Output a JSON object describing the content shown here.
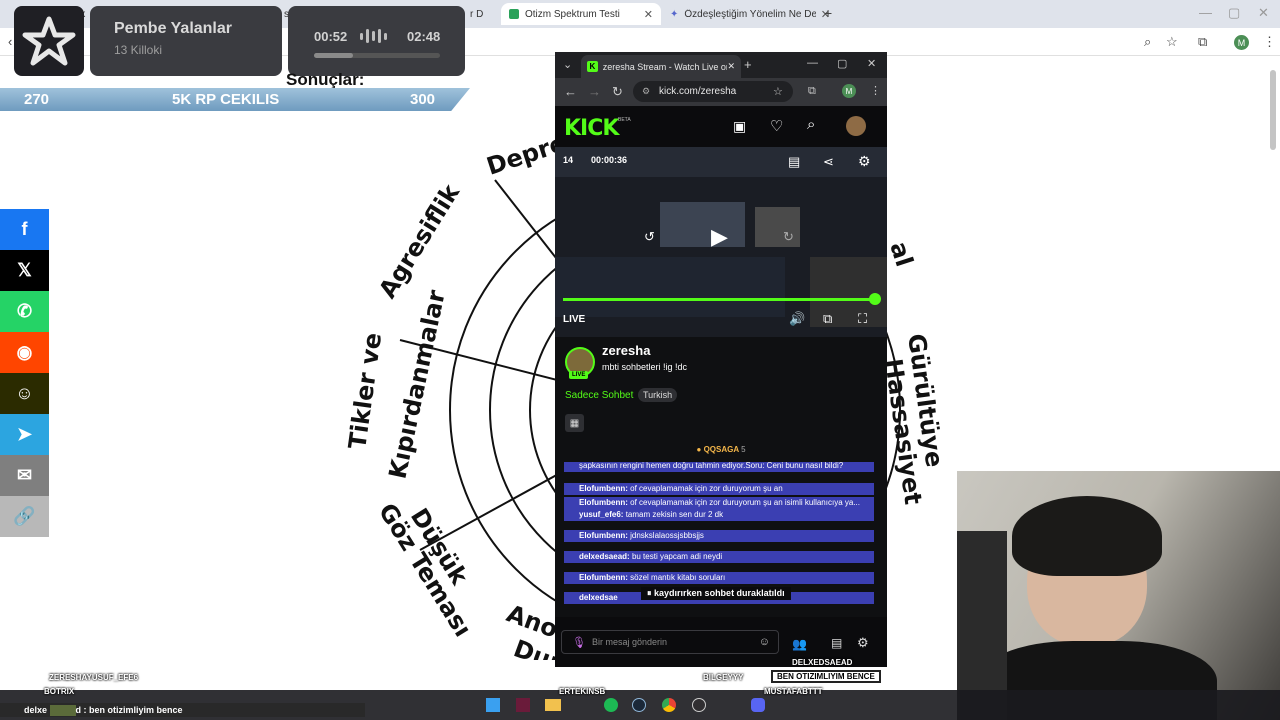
{
  "outer_browser": {
    "tabs": [
      {
        "label": "ik"
      },
      {
        "label": "st"
      },
      {
        "label": "r D"
      },
      {
        "label": "Otizm Spektrum Testi"
      },
      {
        "label": "Özdeşleştiğim Yönelim Ne Den"
      }
    ],
    "new_tab": "+",
    "avatar_letter": "M"
  },
  "overlay": {
    "song_title": "Pembe Yalanlar",
    "song_artist": "13 Killoki",
    "time_current": "00:52",
    "time_total": "02:48",
    "song_progress_fraction": 0.31,
    "results_heading": "Sonuçlar:",
    "goal_left": "270",
    "goal_title": "5K RP CEKILIS",
    "goal_right": "300"
  },
  "share_sidebar": [
    {
      "name": "facebook",
      "glyph": "f",
      "color": "#1877f2"
    },
    {
      "name": "x",
      "glyph": "𝕏",
      "color": "#000000"
    },
    {
      "name": "whatsapp",
      "glyph": "✆",
      "color": "#25d366"
    },
    {
      "name": "reddit",
      "glyph": "◉",
      "color": "#ff4500"
    },
    {
      "name": "snapchat",
      "glyph": "☺",
      "color": "#2b2b00"
    },
    {
      "name": "telegram",
      "glyph": "➤",
      "color": "#2ca5e0"
    },
    {
      "name": "email",
      "glyph": "✉",
      "color": "#7f7f7f"
    },
    {
      "name": "link",
      "glyph": "🔗",
      "color": "#b8b8b8"
    }
  ],
  "radial_labels": {
    "depression": "Depre",
    "aggression": "Agresiflik",
    "tics": "Tikler ve",
    "twitching": "Kıpırdanmalar",
    "low_eye": "Düşük",
    "eye_contact": "Göz Teması",
    "posture_a": "Ano",
    "posture_b": "Duruş",
    "noise": "Gürültüye",
    "sensitivity": "Hassasiyet",
    "right_fragment": "al"
  },
  "inner_browser": {
    "tab_title": "zeresha Stream - Watch Live on",
    "url": "kick.com/zeresha",
    "avatar_letter": "M"
  },
  "kick": {
    "logo": "KICK",
    "beta": "BETA",
    "viewers": "14",
    "uptime": "00:00:36",
    "live_label": "LIVE",
    "channel_name": "zeresha",
    "stream_title": "mbti sohbetleri !ig !dc",
    "live_badge": "LIVE",
    "category": "Sadece Sohbet",
    "tag": "Turkish",
    "pinned": "QQSAGA",
    "pinned_count": "5",
    "chat": [
      {
        "user": "",
        "text": "şapkasının rengini hemen doğru tahmin ediyor.Soru: Ceni bunu nasıl bildi?"
      },
      {
        "user": "Elofumbenn:",
        "text": "of cevaplamamak için zor duruyorum şu an"
      },
      {
        "user": "Elofumbenn:",
        "text": "of cevaplamamak için zor duruyorum şu an isimli kullanıcıya ya..."
      },
      {
        "user": "yusuf_efe6:",
        "text": "tamam zekisin sen dur 2 dk"
      },
      {
        "user": "Elofumbenn:",
        "text": "jdnskslalaossjsbbsjjs"
      },
      {
        "user": "delxedsaead:",
        "text": "bu testi yapcam adi neydi"
      },
      {
        "user": "Elofumbenn:",
        "text": "sözel mantık kitabı soruları"
      },
      {
        "user": "delxedsae",
        "text": ""
      }
    ],
    "chat_paused": "kaydırırken sohbet duraklatıldı",
    "chat_placeholder": "Bir mesaj gönderin"
  },
  "bottom_overlay": {
    "tag_1": "ZERESHAYUSUF_EFE6",
    "tag_2": "BOTRIX",
    "bottom_chat_user": "delxe",
    "bottom_chat_mid": "d",
    "bottom_chat_text": ": ben otizimliyim bence",
    "tag_3": "ERTEKINSB",
    "tag_4": "BILGEYYY",
    "tag_5": "MUSTAFABTTT",
    "tag_6": "DELXEDSAEAD",
    "highlight": "BEN OTIZIMLIYIM BENCE"
  }
}
